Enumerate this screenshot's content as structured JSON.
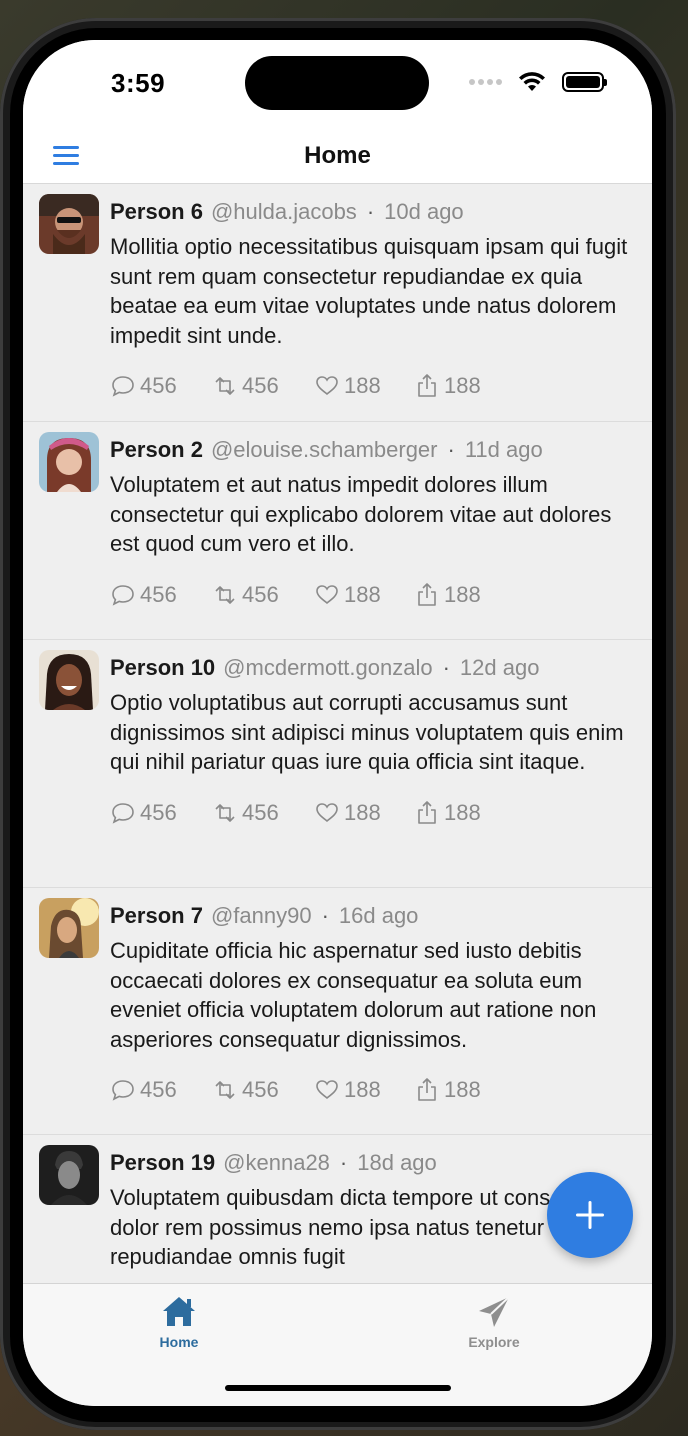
{
  "status_bar": {
    "time": "3:59"
  },
  "nav": {
    "title": "Home"
  },
  "posts": [
    {
      "name": "Person 6",
      "handle": "@hulda.jacobs",
      "separator": "·",
      "time": "10d ago",
      "body": "Mollitia optio necessitatibus quisquam ipsam qui fugit sunt rem quam consectetur repudiandae ex quia beatae ea eum vitae voluptates unde natus dolorem impedit sint unde.",
      "replies": "456",
      "retweets": "456",
      "likes": "188",
      "shares": "188"
    },
    {
      "name": "Person 2",
      "handle": "@elouise.schamberger",
      "separator": "·",
      "time": "11d ago",
      "body": "Voluptatem et aut natus impedit dolores illum consectetur qui explicabo dolorem vitae aut dolores est quod cum vero et illo.",
      "replies": "456",
      "retweets": "456",
      "likes": "188",
      "shares": "188"
    },
    {
      "name": "Person 10",
      "handle": "@mcdermott.gonzalo",
      "separator": "·",
      "time": "12d ago",
      "body": "Optio voluptatibus aut corrupti accusamus sunt dignissimos sint adipisci minus voluptatem quis enim qui nihil pariatur quas iure quia officia sint itaque.",
      "replies": "456",
      "retweets": "456",
      "likes": "188",
      "shares": "188"
    },
    {
      "name": "Person 7",
      "handle": "@fanny90",
      "separator": "·",
      "time": "16d ago",
      "body": "Cupiditate officia hic aspernatur sed iusto debitis occaecati dolores ex consequatur ea soluta eum eveniet officia voluptatem dolorum aut ratione non asperiores consequatur dignissimos.",
      "replies": "456",
      "retweets": "456",
      "likes": "188",
      "shares": "188"
    },
    {
      "name": "Person 19",
      "handle": "@kenna28",
      "separator": "·",
      "time": "18d ago",
      "body": "Voluptatem quibusdam dicta tempore ut consequatur dolor rem possimus nemo ipsa natus tenetur ab repudiandae omnis fugit",
      "replies": "",
      "retweets": "",
      "likes": "",
      "shares": ""
    }
  ],
  "tabs": {
    "home": "Home",
    "explore": "Explore"
  },
  "colors": {
    "accent": "#2f7de1",
    "tab_active": "#2d6c9e",
    "feed_bg": "#efefef",
    "muted_text": "#8a8a8a"
  },
  "icons": {
    "reply": "speech-bubble-icon",
    "retweet": "retweet-icon",
    "like": "heart-icon",
    "share": "share-icon",
    "compose": "plus-icon"
  }
}
